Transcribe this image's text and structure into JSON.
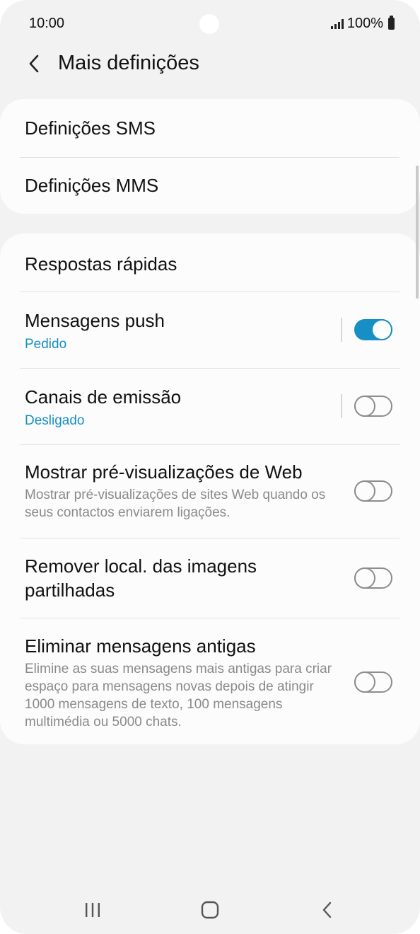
{
  "status_bar": {
    "time": "10:00",
    "battery_text": "100%"
  },
  "header": {
    "title": "Mais definições",
    "back_icon": "chevron-left-icon"
  },
  "cards": [
    {
      "items": [
        {
          "title": "Definições SMS"
        },
        {
          "title": "Definições MMS"
        }
      ]
    },
    {
      "items": [
        {
          "title": "Respostas rápidas"
        },
        {
          "title": "Mensagens push",
          "subtitle": "Pedido",
          "toggle": true
        },
        {
          "title": "Canais de emissão",
          "subtitle": "Desligado",
          "toggle": false
        },
        {
          "title": "Mostrar pré-visualizações de Web",
          "description": "Mostrar pré-visualizações de sites Web quando os seus contactos enviarem ligações.",
          "toggle": false
        },
        {
          "title": "Remover local. das imagens partilhadas",
          "toggle": false
        },
        {
          "title": "Eliminar mensagens antigas",
          "description": "Elimine as suas mensagens mais antigas para criar espaço para mensagens novas depois de atingir 1000 mensagens de texto, 100 mensagens multimédia ou 5000 chats.",
          "toggle": false
        }
      ]
    }
  ],
  "nav_bar": {
    "recents_icon": "recent-apps-icon",
    "home_icon": "home-icon",
    "back_icon": "back-icon"
  },
  "colors": {
    "accent": "#1690c4",
    "background": "#f2f2f2",
    "card": "#fcfcfc"
  }
}
